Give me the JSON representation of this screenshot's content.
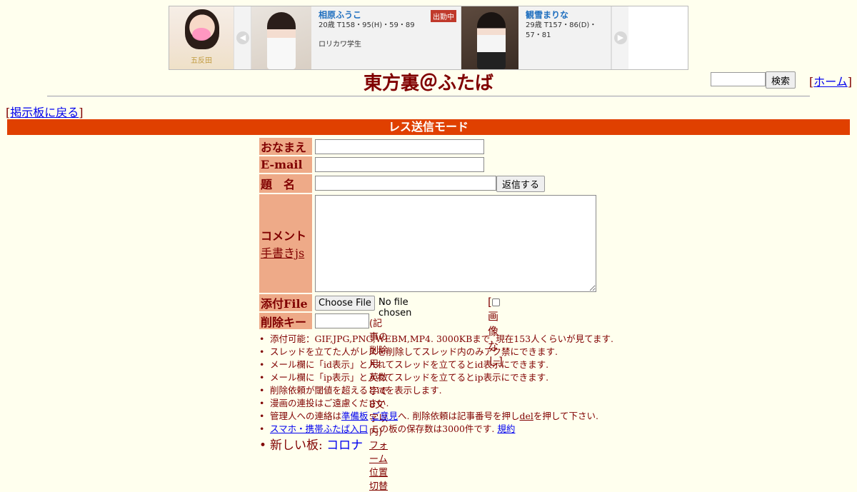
{
  "ad": {
    "logo_text": "五反田",
    "prev_icon": "chevron-left-icon",
    "next_icon": "chevron-right-icon",
    "cards": [
      {
        "name": "相原ふうこ",
        "stats": "20歳 T158・95(H)・59・89",
        "desc": "ロリカワ学生",
        "badge": "出勤中"
      },
      {
        "name": "観雪まりな",
        "stats": "29歳 T157・86(D)・57・81",
        "desc": "",
        "badge": ""
      }
    ]
  },
  "header": {
    "title": "東方裏＠ふたば",
    "search_button": "検索",
    "home_link": "ホーム",
    "back_link": "掲示板に戻る"
  },
  "mode_bar": "レス送信モード",
  "form": {
    "name_label": "おなまえ",
    "email_label": "E-mail",
    "subject_label": "題　名",
    "submit_button": "返信する",
    "comment_label": "コメント",
    "oekaki_link": "手書きjs",
    "file_label": "添付File",
    "choose_file_button": "Choose File",
    "no_file_text": "No file chosen",
    "no_image_label": "画像なし",
    "delkey_label": "削除キー",
    "delkey_note": "(記事の削除用。英数字で8文字以内)",
    "form_switch_link": "フォーム位置切替"
  },
  "rules": {
    "r1": "添付可能：GIF,JPG,PNG,WEBM,MP4. 3000KBまで. 現在153人くらいが見てます.",
    "r2": "スレッドを立てた人がレスを削除してスレッド内のみアク禁にできます.",
    "r3": "メール欄に「id表示」と入れてスレッドを立てるとid表示にできます.",
    "r4": "メール欄に「ip表示」と入れてスレッドを立てるとip表示にできます.",
    "r5": "削除依頼が閾値を超えるとidを表示します.",
    "r6": "漫画の連投はご遠慮ください.",
    "r7_pre": "管理人への連絡は",
    "r7_link1": "準備板",
    "r7_link2": "ご意見",
    "r7_mid": "へ. 削除依頼は記事番号を押し",
    "r7_link3": "del",
    "r7_post": "を押して下さい.",
    "r8_link1": "スマホ・携帯ふたば入口",
    "r8_mid": "この板の保存数は3000件です.",
    "r8_link2": "規約",
    "r9_pre": "新しい板: ",
    "r9_link": "コロナ"
  }
}
